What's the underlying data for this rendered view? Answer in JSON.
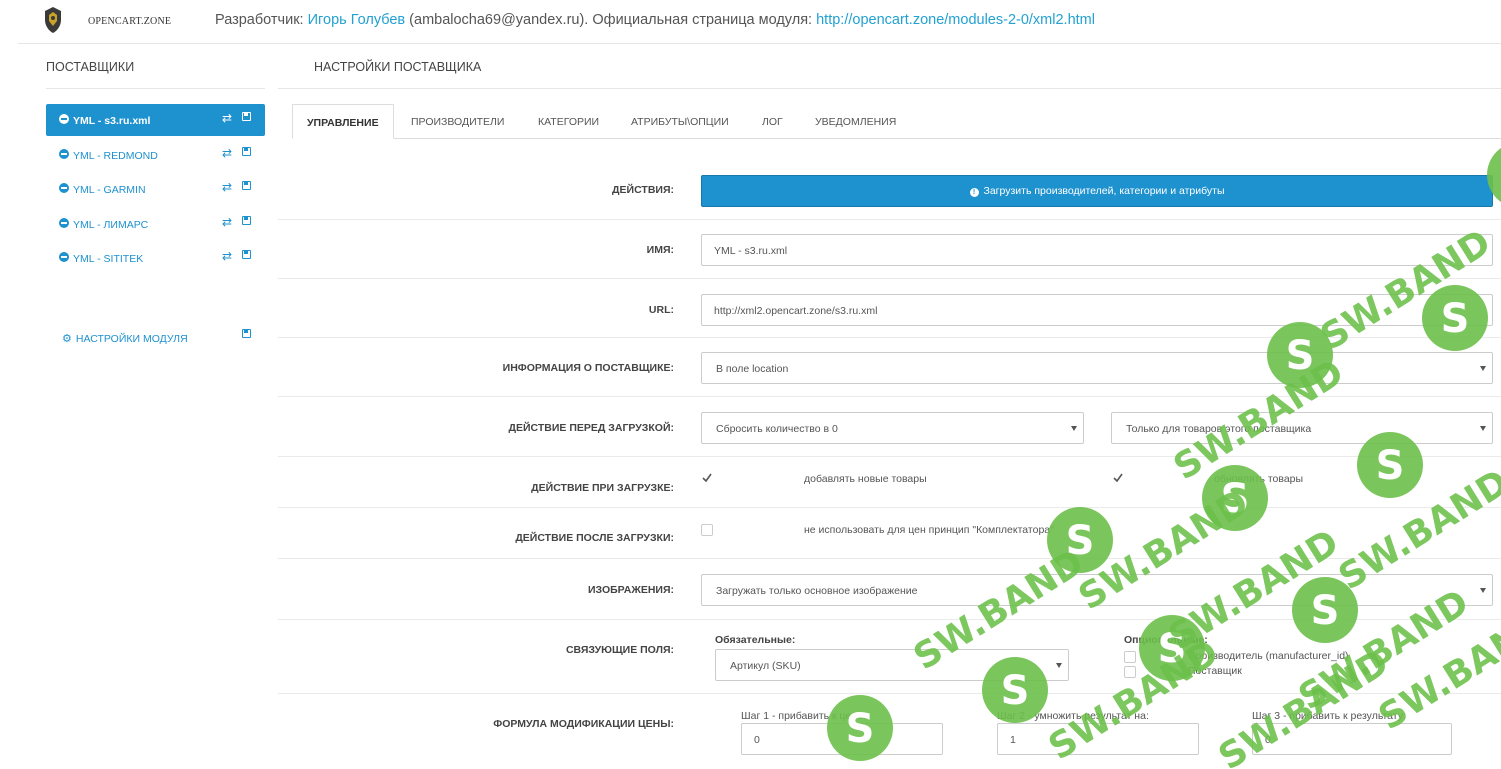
{
  "header": {
    "logo_text": "OPENCART.ZONE",
    "developer_label": "Разработчик:",
    "developer_name": "Игорь Голубев",
    "developer_email": "(ambalocha69@yandex.ru).",
    "page_label": "Официальная страница модуля:",
    "page_url": "http://opencart.zone/modules-2-0/xml2.html"
  },
  "sidebar": {
    "title": "ПОСТАВЩИКИ",
    "items": [
      {
        "label": "YML - s3.ru.xml",
        "active": true
      },
      {
        "label": "YML - REDMOND",
        "active": false
      },
      {
        "label": "YML - GARMIN",
        "active": false
      },
      {
        "label": "YML - ЛИМАРС",
        "active": false
      },
      {
        "label": "YML - SITITEK",
        "active": false
      }
    ],
    "module_settings": "НАСТРОЙКИ МОДУЛЯ"
  },
  "main": {
    "title": "НАСТРОЙКИ ПОСТАВЩИКА",
    "tabs": [
      "УПРАВЛЕНИЕ",
      "ПРОИЗВОДИТЕЛИ",
      "КАТЕГОРИИ",
      "АТРИБУТЫ\\ОПЦИИ",
      "ЛОГ",
      "УВЕДОМЛЕНИЯ"
    ],
    "active_tab": "УПРАВЛЕНИЕ"
  },
  "form": {
    "actions": {
      "label": "ДЕЙСТВИЯ:",
      "button": "Загрузить производителей, категории и атрибуты"
    },
    "name": {
      "label": "ИМЯ:",
      "value": "YML - s3.ru.xml"
    },
    "url": {
      "label": "URL:",
      "value": "http://xml2.opencart.zone/s3.ru.xml"
    },
    "supplier_info": {
      "label": "ИНФОРМАЦИЯ О ПОСТАВЩИКЕ:",
      "value": "В поле location"
    },
    "before_load": {
      "label": "ДЕЙСТВИЕ ПЕРЕД ЗАГРУЗКОЙ:",
      "value1": "Сбросить количество в 0",
      "value2": "Только для товаров этого поставщика"
    },
    "on_load": {
      "label": "ДЕЙСТВИЕ ПРИ ЗАГРУЗКЕ:",
      "check1": "добавлять новые товары",
      "check1_checked": true,
      "check2": "обновлять товары",
      "check2_checked": true
    },
    "after_load": {
      "label": "ДЕЙСТВИЕ ПОСЛЕ ЗАГРУЗКИ:",
      "check1": "не использовать для цен принцип \"Комплектатора\"",
      "check1_checked": false
    },
    "images": {
      "label": "ИЗОБРАЖЕНИЯ:",
      "value": "Загружать только основное изображение"
    },
    "link_fields": {
      "label": "СВЯЗУЮЩИЕ ПОЛЯ:",
      "required_label": "Обязательные:",
      "required_value": "Артикул (SKU)",
      "optional_label": "Опциональные:",
      "optional1": "Производитель (manufacturer_id)",
      "optional2": "Поставщик"
    },
    "price_formula": {
      "label": "ФОРМУЛА МОДИФИКАЦИИ ЦЕНЫ:",
      "step1_label": "Шаг 1 - прибавить к цене:",
      "step1_value": "0",
      "step2_label": "Шаг 2 - умножить результат на:",
      "step2_value": "1",
      "step3_label": "Шаг 3 - прибавить к результату:",
      "step3_value": "0"
    }
  },
  "watermark": {
    "text": "SW.BAND",
    "letter": "S"
  },
  "colors": {
    "accent": "#1e91cf",
    "watermark": "#6cc04a"
  }
}
